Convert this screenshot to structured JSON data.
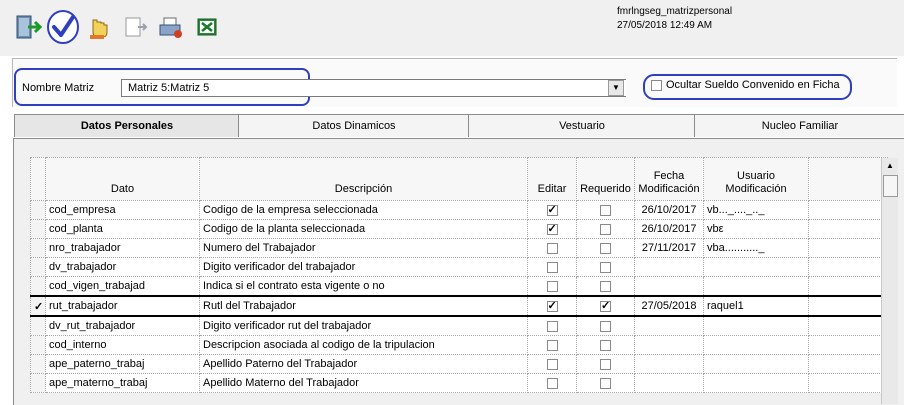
{
  "window": {
    "form_name": "fmrlngseg_matrizpersonal",
    "datetime": "27/05/2018 12:49 AM"
  },
  "toolbar": {
    "icons": [
      "exit-door-icon",
      "accept-check-icon",
      "hand-pointer-icon",
      "document-arrow-icon",
      "print-icon",
      "excel-export-icon"
    ]
  },
  "filter": {
    "matrix_label": "Nombre Matriz",
    "matrix_value": "Matriz 5:Matriz 5",
    "hide_salary_label": "Ocultar Sueldo Convenido en Ficha",
    "hide_salary_checked": false
  },
  "tabs": [
    {
      "label": "Datos Personales",
      "active": true
    },
    {
      "label": "Datos Dinamicos",
      "active": false
    },
    {
      "label": "Vestuario",
      "active": false
    },
    {
      "label": "Nucleo Familiar",
      "active": false
    }
  ],
  "grid": {
    "headers": {
      "dato": "Dato",
      "descripcion": "Descripción",
      "editar": "Editar",
      "requerido": "Requerido",
      "fecha": "Fecha Modificación",
      "usuario": "Usuario Modificación"
    },
    "rows": [
      {
        "dato": "cod_empresa",
        "descripcion": "Codigo de la empresa seleccionada",
        "editar": true,
        "requerido": false,
        "fecha": "26/10/2017",
        "usuario": "vb..._...._.._",
        "current": false
      },
      {
        "dato": "cod_planta",
        "descripcion": "Codigo de la planta seleccionada",
        "editar": true,
        "requerido": false,
        "fecha": "26/10/2017",
        "usuario": "vbε",
        "current": false
      },
      {
        "dato": "nro_trabajador",
        "descripcion": "Numero del Trabajador",
        "editar": false,
        "requerido": false,
        "fecha": "27/11/2017",
        "usuario": "vba..........._",
        "current": false
      },
      {
        "dato": "dv_trabajador",
        "descripcion": "Digito verificador del trabajador",
        "editar": false,
        "requerido": false,
        "fecha": "",
        "usuario": "",
        "current": false
      },
      {
        "dato": "cod_vigen_trabajad",
        "descripcion": "Indica si el contrato esta vigente o no",
        "editar": false,
        "requerido": false,
        "fecha": "",
        "usuario": "",
        "current": false
      },
      {
        "dato": "rut_trabajador",
        "descripcion": "Rutl del Trabajador",
        "editar": true,
        "requerido": true,
        "fecha": "27/05/2018",
        "usuario": "raquel1",
        "current": true
      },
      {
        "dato": "dv_rut_trabajador",
        "descripcion": "Digito verificador rut del trabajador",
        "editar": false,
        "requerido": false,
        "fecha": "",
        "usuario": "",
        "current": false
      },
      {
        "dato": "cod_interno",
        "descripcion": "Descripcion asociada al codigo de la tripulacion",
        "editar": false,
        "requerido": false,
        "fecha": "",
        "usuario": "",
        "current": false
      },
      {
        "dato": "ape_paterno_trabaj",
        "descripcion": "Apellido Paterno del Trabajador",
        "editar": false,
        "requerido": false,
        "fecha": "",
        "usuario": "",
        "current": false
      },
      {
        "dato": "ape_materno_trabaj",
        "descripcion": "Apellido Materno del Trabajador",
        "editar": false,
        "requerido": false,
        "fecha": "",
        "usuario": "",
        "current": false
      }
    ]
  },
  "colors": {
    "highlight_circle": "#2f3fbf",
    "toolbar_bg": "#f0f0f0"
  }
}
